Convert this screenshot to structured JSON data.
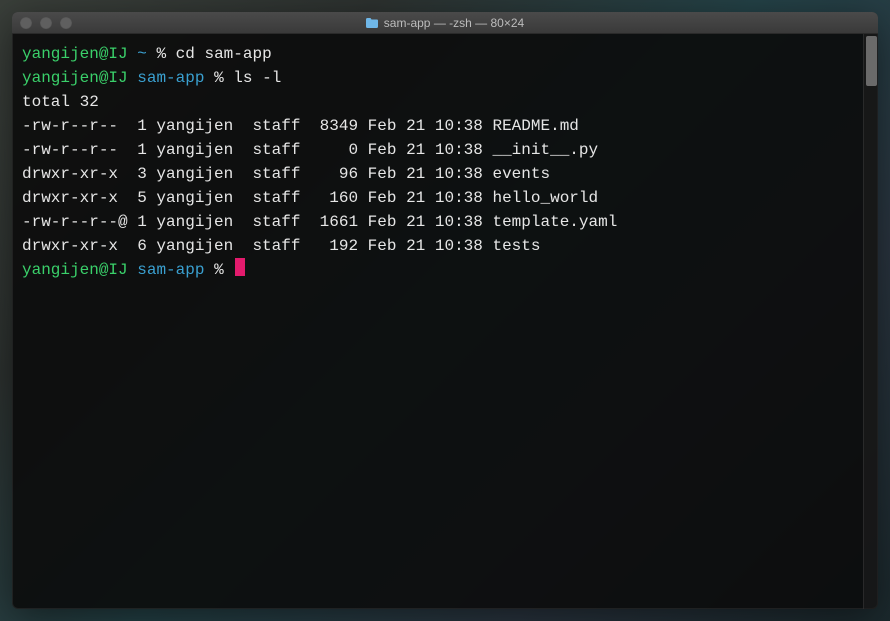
{
  "window": {
    "title": "sam-app — -zsh — 80×24",
    "icon": "folder-icon"
  },
  "colors": {
    "user": "#3ad06a",
    "path": "#3aa0d0",
    "cursor": "#e31b6d"
  },
  "session": {
    "user_host": "yangijen@IJ",
    "lines": [
      {
        "prompt_path": "~",
        "cmd": "cd sam-app"
      },
      {
        "prompt_path": "sam-app",
        "cmd": "ls -l"
      }
    ],
    "ls_header": "total 32",
    "ls_rows": [
      {
        "perm": "-rw-r--r--",
        "extra": " ",
        "links": "1",
        "owner": "yangijen",
        "group": "staff",
        "size": "8349",
        "month": "Feb",
        "day": "21",
        "time": "10:38",
        "name": "README.md"
      },
      {
        "perm": "-rw-r--r--",
        "extra": " ",
        "links": "1",
        "owner": "yangijen",
        "group": "staff",
        "size": "0",
        "month": "Feb",
        "day": "21",
        "time": "10:38",
        "name": "__init__.py"
      },
      {
        "perm": "drwxr-xr-x",
        "extra": " ",
        "links": "3",
        "owner": "yangijen",
        "group": "staff",
        "size": "96",
        "month": "Feb",
        "day": "21",
        "time": "10:38",
        "name": "events"
      },
      {
        "perm": "drwxr-xr-x",
        "extra": " ",
        "links": "5",
        "owner": "yangijen",
        "group": "staff",
        "size": "160",
        "month": "Feb",
        "day": "21",
        "time": "10:38",
        "name": "hello_world"
      },
      {
        "perm": "-rw-r--r--",
        "extra": "@",
        "links": "1",
        "owner": "yangijen",
        "group": "staff",
        "size": "1661",
        "month": "Feb",
        "day": "21",
        "time": "10:38",
        "name": "template.yaml"
      },
      {
        "perm": "drwxr-xr-x",
        "extra": " ",
        "links": "6",
        "owner": "yangijen",
        "group": "staff",
        "size": "192",
        "month": "Feb",
        "day": "21",
        "time": "10:38",
        "name": "tests"
      }
    ],
    "current_prompt_path": "sam-app",
    "prompt_symbol": "%"
  }
}
